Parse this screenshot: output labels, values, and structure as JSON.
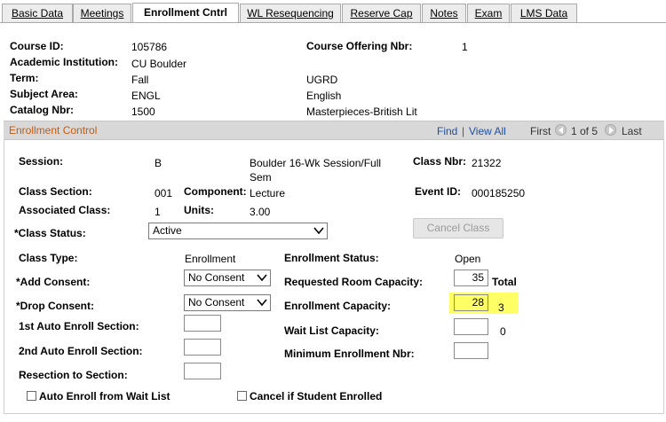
{
  "tabs": [
    {
      "label": "Basic Data"
    },
    {
      "label": "Meetings"
    },
    {
      "label": "Enrollment Cntrl"
    },
    {
      "label": "WL Resequencing"
    },
    {
      "label": "Reserve Cap"
    },
    {
      "label": "Notes"
    },
    {
      "label": "Exam"
    },
    {
      "label": "LMS Data"
    }
  ],
  "header": {
    "course_id_label": "Course ID:",
    "course_id": "105786",
    "offering_label": "Course Offering Nbr:",
    "offering": "1",
    "institution_label": "Academic Institution:",
    "institution": "CU Boulder",
    "term_label": "Term:",
    "term": "Fall",
    "career": "UGRD",
    "subject_label": "Subject Area:",
    "subject": "ENGL",
    "subject_desc": "English",
    "catalog_label": "Catalog Nbr:",
    "catalog": "1500",
    "catalog_desc": "Masterpieces-British Lit"
  },
  "section": {
    "title": "Enrollment Control",
    "find": "Find",
    "sep": "|",
    "view_all": "View All",
    "first": "First",
    "position": "1 of 5",
    "last": "Last"
  },
  "form": {
    "session_label": "Session:",
    "session": "B",
    "session_desc_1": "Boulder 16-Wk Session/Full",
    "session_desc_2": "Sem",
    "class_nbr_label": "Class Nbr:",
    "class_nbr": "21322",
    "class_section_label": "Class Section:",
    "class_section": "001",
    "component_label": "Component:",
    "component": "Lecture",
    "event_id_label": "Event ID:",
    "event_id": "000185250",
    "assoc_class_label": "Associated Class:",
    "assoc_class": "1",
    "units_label": "Units:",
    "units": "3.00",
    "class_status_label": "*Class Status:",
    "class_status": "Active",
    "cancel_class": "Cancel Class",
    "class_type_label": "Class Type:",
    "class_type": "Enrollment",
    "enroll_status_label": "Enrollment Status:",
    "enroll_status": "Open",
    "add_consent_label": "*Add Consent:",
    "add_consent": "No Consent",
    "req_room_cap_label": "Requested Room Capacity:",
    "req_room_cap": "35",
    "total_label": "Total",
    "drop_consent_label": "*Drop Consent:",
    "drop_consent": "No Consent",
    "enroll_cap_label": "Enrollment Capacity:",
    "enroll_cap": "28",
    "enroll_total": "3",
    "auto1_label": "1st Auto Enroll Section:",
    "auto1": "",
    "waitlist_cap_label": "Wait List Capacity:",
    "waitlist_cap": "",
    "waitlist_total": "0",
    "auto2_label": "2nd Auto Enroll Section:",
    "auto2": "",
    "min_enroll_label": "Minimum Enrollment Nbr:",
    "min_enroll": "",
    "resection_label": "Resection to Section:",
    "resection": "",
    "auto_wait_label": "Auto Enroll from Wait List",
    "cancel_if_label": "Cancel if Student Enrolled"
  },
  "colors": {
    "highlight": "#ffff66",
    "section_title": "#c75a0f",
    "link": "#1f4fa3"
  }
}
